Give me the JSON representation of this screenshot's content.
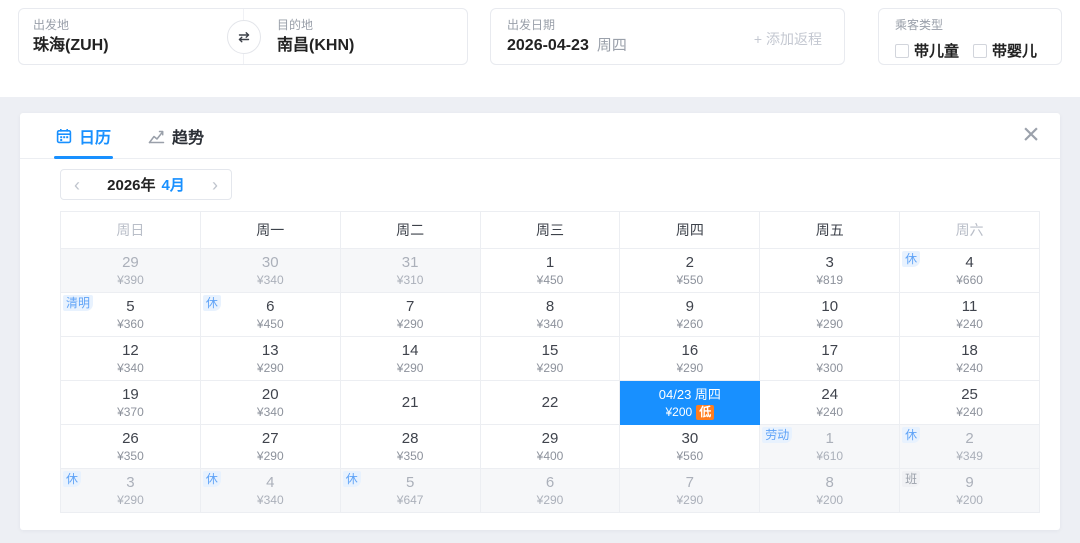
{
  "search_bar": {
    "origin": {
      "label": "出发地",
      "value": "珠海(ZUH)"
    },
    "swap_icon": "swap-arrows-icon",
    "destination": {
      "label": "目的地",
      "value": "南昌(KHN)"
    },
    "depart_date": {
      "label": "出发日期",
      "value": "2026-04-23",
      "weekday": "周四",
      "add_return": "+ 添加返程"
    },
    "passenger_type": {
      "label": "乘客类型",
      "options": [
        {
          "label": "带儿童",
          "checked": false
        },
        {
          "label": "带婴儿",
          "checked": false
        }
      ]
    }
  },
  "panel": {
    "tabs": [
      {
        "label": "日历",
        "icon": "calendar-icon",
        "active": true
      },
      {
        "label": "趋势",
        "icon": "trend-chart-icon",
        "active": false
      }
    ],
    "close_icon": "×",
    "month_nav": {
      "prev": "‹",
      "year": "2026年",
      "month": "4月",
      "next": "›"
    }
  },
  "calendar": {
    "weekdays": [
      "周日",
      "周一",
      "周二",
      "周三",
      "周四",
      "周五",
      "周六"
    ],
    "weekday_muted": [
      true,
      false,
      false,
      false,
      false,
      false,
      true
    ],
    "weeks": [
      [
        {
          "day": "29",
          "price": "¥390",
          "muted": true
        },
        {
          "day": "30",
          "price": "¥340",
          "muted": true
        },
        {
          "day": "31",
          "price": "¥310",
          "muted": true
        },
        {
          "day": "1",
          "price": "¥450"
        },
        {
          "day": "2",
          "price": "¥550"
        },
        {
          "day": "3",
          "price": "¥819"
        },
        {
          "day": "4",
          "price": "¥660",
          "badge": "休"
        }
      ],
      [
        {
          "day": "5",
          "price": "¥360",
          "badge": "清明"
        },
        {
          "day": "6",
          "price": "¥450",
          "badge": "休"
        },
        {
          "day": "7",
          "price": "¥290"
        },
        {
          "day": "8",
          "price": "¥340"
        },
        {
          "day": "9",
          "price": "¥260"
        },
        {
          "day": "10",
          "price": "¥290"
        },
        {
          "day": "11",
          "price": "¥240"
        }
      ],
      [
        {
          "day": "12",
          "price": "¥340"
        },
        {
          "day": "13",
          "price": "¥290"
        },
        {
          "day": "14",
          "price": "¥290"
        },
        {
          "day": "15",
          "price": "¥290"
        },
        {
          "day": "16",
          "price": "¥290"
        },
        {
          "day": "17",
          "price": "¥300"
        },
        {
          "day": "18",
          "price": "¥240"
        }
      ],
      [
        {
          "day": "19",
          "price": "¥370"
        },
        {
          "day": "20",
          "price": "¥340"
        },
        {
          "day": "21",
          "price": ""
        },
        {
          "day": "22",
          "price": ""
        },
        {
          "day": "04/23 周四",
          "price": "¥200",
          "selected": true,
          "low_tag": "低"
        },
        {
          "day": "24",
          "price": "¥240"
        },
        {
          "day": "25",
          "price": "¥240"
        }
      ],
      [
        {
          "day": "26",
          "price": "¥350"
        },
        {
          "day": "27",
          "price": "¥290"
        },
        {
          "day": "28",
          "price": "¥350"
        },
        {
          "day": "29",
          "price": "¥400"
        },
        {
          "day": "30",
          "price": "¥560"
        },
        {
          "day": "1",
          "price": "¥610",
          "muted": true,
          "badge": "劳动"
        },
        {
          "day": "2",
          "price": "¥349",
          "muted": true,
          "badge": "休"
        }
      ],
      [
        {
          "day": "3",
          "price": "¥290",
          "muted": true,
          "badge": "休"
        },
        {
          "day": "4",
          "price": "¥340",
          "muted": true,
          "badge": "休"
        },
        {
          "day": "5",
          "price": "¥647",
          "muted": true,
          "badge": "休"
        },
        {
          "day": "6",
          "price": "¥290",
          "muted": true
        },
        {
          "day": "7",
          "price": "¥290",
          "muted": true
        },
        {
          "day": "8",
          "price": "¥200",
          "muted": true
        },
        {
          "day": "9",
          "price": "¥200",
          "muted": true,
          "badge": "班",
          "badge_grey": true
        }
      ]
    ]
  },
  "colors": {
    "accent": "#1890ff",
    "selected_cell_bg": "#1890ff",
    "low_badge_bg": "#ff7d1f",
    "holiday_badge_text": "#5fa3f7",
    "holiday_badge_bg": "#e8f2fe",
    "muted_cell_bg": "#f6f7f9",
    "page_band_bg": "#edeff4"
  }
}
